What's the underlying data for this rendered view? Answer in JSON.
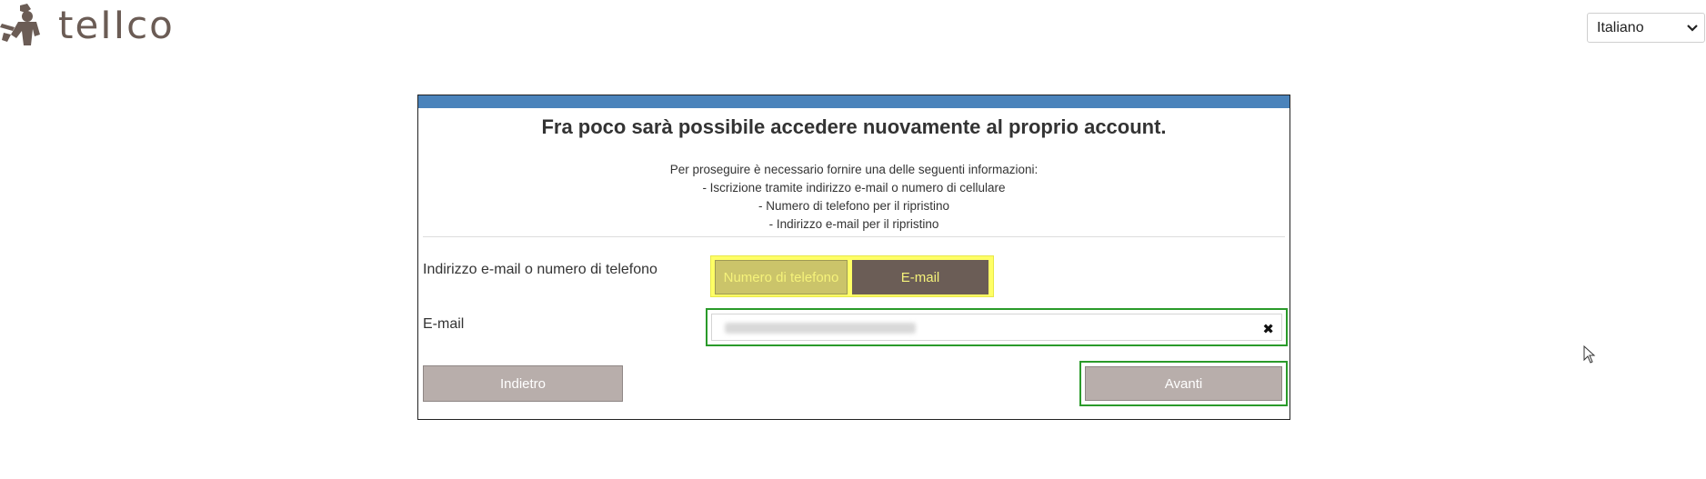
{
  "brand": {
    "logo_text": "teIIco"
  },
  "language": {
    "selected": "Italiano"
  },
  "card": {
    "title": "Fra poco sarà possibile accedere nuovamente al proprio account.",
    "info_lines": [
      "Per proseguire è necessario fornire una delle seguenti informazioni:",
      "- Iscrizione tramite indirizzo e-mail o numero di cellulare",
      "- Numero di telefono per il ripristino",
      "- Indirizzo e-mail per il ripristino"
    ],
    "method_label": "Indirizzo e-mail o numero di telefono",
    "method_options": {
      "phone": "Numero di telefono",
      "email": "E-mail"
    },
    "email_label": "E-mail",
    "email_value_redacted": "",
    "back_button": "Indietro",
    "next_button": "Avanti"
  },
  "colors": {
    "topbar": "#4a83bb",
    "brand_brown": "#6b5c55",
    "highlight_yellow": "#ffff66",
    "highlight_green": "#2a9a2a",
    "button_grey": "#b8aeab"
  }
}
